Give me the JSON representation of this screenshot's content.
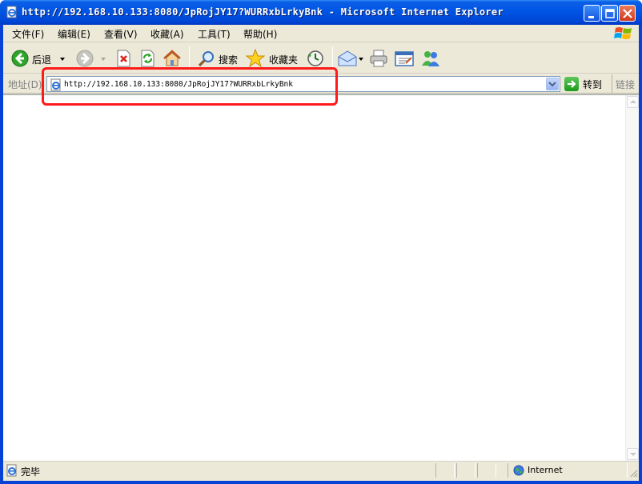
{
  "window": {
    "title": "http://192.168.10.133:8080/JpRojJY17?WURRxbLrkyBnk - Microsoft Internet Explorer"
  },
  "menubar": {
    "items": [
      {
        "label": "文件(F)"
      },
      {
        "label": "编辑(E)"
      },
      {
        "label": "查看(V)"
      },
      {
        "label": "收藏(A)"
      },
      {
        "label": "工具(T)"
      },
      {
        "label": "帮助(H)"
      }
    ]
  },
  "toolbar": {
    "back_label": "后退",
    "search_label": "搜索",
    "favorites_label": "收藏夹"
  },
  "addressbar": {
    "label": "地址(D)",
    "url": "http://192.168.10.133:8080/JpRojJY17?WURRxbLrkyBnk",
    "go_label": "转到",
    "links_label": "链接"
  },
  "statusbar": {
    "status_text": "完毕",
    "zone_text": "Internet"
  },
  "icons": {
    "window": "ie-page-icon",
    "minimize": "minimize-icon",
    "maximize": "maximize-icon",
    "close": "close-icon",
    "back": "back-arrow-icon",
    "forward": "forward-arrow-icon",
    "stop": "stop-icon",
    "refresh": "refresh-icon",
    "home": "home-icon",
    "search": "search-icon",
    "favorites": "star-icon",
    "history": "history-icon",
    "mail": "mail-icon",
    "print": "print-icon",
    "edit": "edit-icon",
    "messenger": "messenger-icon"
  },
  "colors": {
    "titlebar": "#0055e4",
    "chrome": "#ece9d8",
    "highlight": "#ff1a1a"
  }
}
